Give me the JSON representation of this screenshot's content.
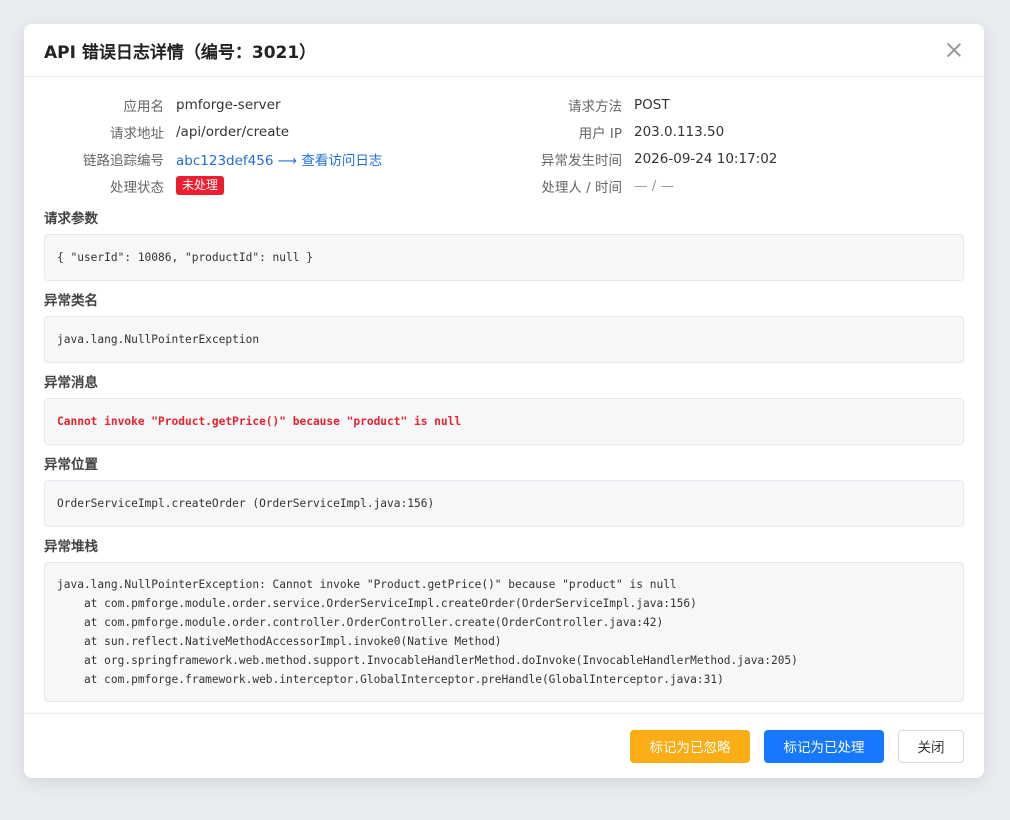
{
  "dialog": {
    "title": "API 错误日志详情（编号：3021）"
  },
  "info": {
    "left": [
      {
        "label": "应用名",
        "value": "pmforge-server"
      },
      {
        "label": "请求地址",
        "value": "/api/order/create"
      },
      {
        "label": "链路追踪编号",
        "value": "abc123def456 ⟶ 查看访问日志"
      },
      {
        "label": "处理状态",
        "value": "未处理"
      }
    ],
    "right": [
      {
        "label": "请求方法",
        "value": "POST"
      },
      {
        "label": "用户 IP",
        "value": "203.0.113.50"
      },
      {
        "label": "异常发生时间",
        "value": "2026-09-24 10:17:02"
      },
      {
        "label": "处理人 / 时间",
        "value": "— / —"
      }
    ]
  },
  "sections": {
    "params": {
      "title": "请求参数",
      "content": "{ \"userId\": 10086, \"productId\": null }"
    },
    "exception_class": {
      "title": "异常类名",
      "content": "java.lang.NullPointerException"
    },
    "exception_message": {
      "title": "异常消息",
      "content": "Cannot invoke \"Product.getPrice()\" because \"product\" is null"
    },
    "exception_location": {
      "title": "异常位置",
      "content": "OrderServiceImpl.createOrder (OrderServiceImpl.java:156)"
    },
    "stack": {
      "title": "异常堆栈",
      "content": "java.lang.NullPointerException: Cannot invoke \"Product.getPrice()\" because \"product\" is null\n    at com.pmforge.module.order.service.OrderServiceImpl.createOrder(OrderServiceImpl.java:156)\n    at com.pmforge.module.order.controller.OrderController.create(OrderController.java:42)\n    at sun.reflect.NativeMethodAccessorImpl.invoke0(Native Method)\n    at org.springframework.web.method.support.InvocableHandlerMethod.doInvoke(InvocableHandlerMethod.java:205)\n    at com.pmforge.framework.web.interceptor.GlobalInterceptor.preHandle(GlobalInterceptor.java:31)"
    }
  },
  "footer": {
    "ignore_label": "标记为已忽略",
    "handled_label": "标记为已处理",
    "close_label": "关闭"
  },
  "colors": {
    "warn": "#faad14",
    "primary": "#1677ff",
    "danger": "#ee1d2f",
    "link": "#1f6fd8"
  },
  "icons": {
    "close": "close-icon"
  }
}
